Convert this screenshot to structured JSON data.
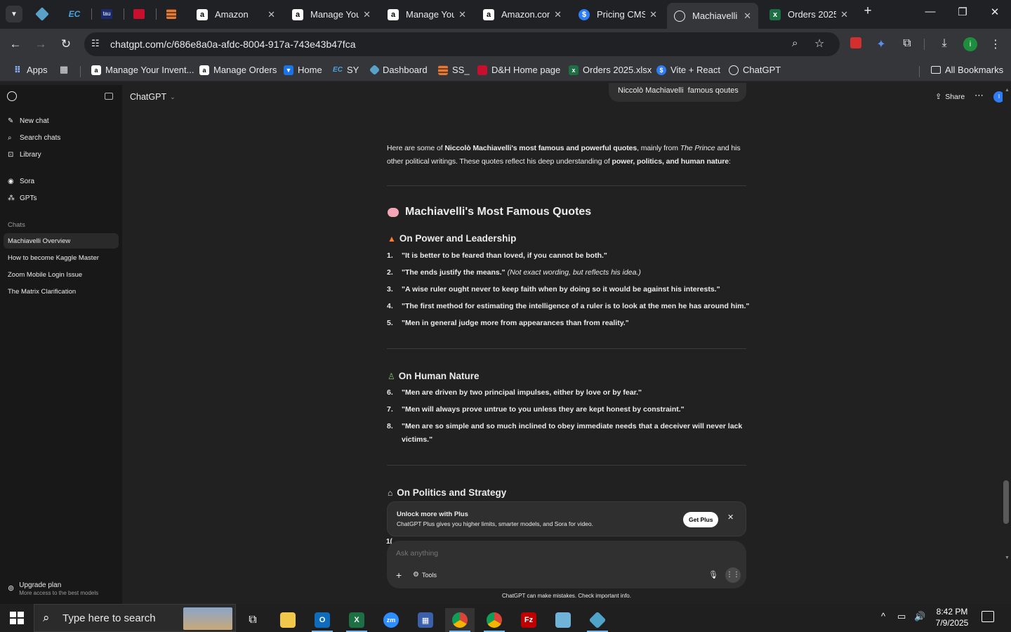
{
  "tabs": [
    {
      "label": "Amazon"
    },
    {
      "label": "Manage Your"
    },
    {
      "label": "Manage Your"
    },
    {
      "label": "Amazon.com"
    },
    {
      "label": "Pricing CMS"
    },
    {
      "label": "Machiavelli"
    },
    {
      "label": "Orders 2025"
    }
  ],
  "address": {
    "url": "chatgpt.com/c/686e8a0a-afdc-8004-917a-743e43b47fca"
  },
  "bookmarks": {
    "apps": "Apps",
    "items": [
      "Manage Your Invent...",
      "Manage Orders",
      "Home",
      "SY",
      "Dashboard",
      "SS_",
      "D&H Home page",
      "Orders 2025.xlsx",
      "Vite + React",
      "ChatGPT"
    ],
    "all": "All Bookmarks"
  },
  "sidebar": {
    "new_chat": "New chat",
    "search_chats": "Search chats",
    "library": "Library",
    "sora": "Sora",
    "gpts": "GPTs",
    "chats_heading": "Chats",
    "chats": [
      "Machiavelli Overview",
      "How to become Kaggle Master",
      "Zoom Mobile Login Issue",
      "The Matrix Clarification"
    ],
    "upgrade_title": "Upgrade plan",
    "upgrade_sub": "More access to the best models"
  },
  "header": {
    "model": "ChatGPT",
    "share": "Share",
    "avatar": "I"
  },
  "user_message": "Niccolò Machiavelli  famous qoutes",
  "response": {
    "intro_p1": "Here are some of ",
    "intro_b1": "Niccolò Machiavelli's most famous and powerful quotes",
    "intro_p2": ", mainly from ",
    "intro_i1": "The Prince",
    "intro_p3": " and his",
    "intro_line2a": "other political writings. These quotes reflect his deep understanding of ",
    "intro_b2": "power, politics, and human nature",
    "intro_p4": ":",
    "title": "Machiavelli's Most Famous Quotes",
    "section1": "On Power and Leadership",
    "s1_quotes": [
      {
        "n": "1.",
        "q": "\"It is better to be feared than loved, if you cannot be both.\"",
        "note": ""
      },
      {
        "n": "2.",
        "q": "\"The ends justify the means.\"",
        "note": " (Not exact wording, but reflects his idea.)"
      },
      {
        "n": "3.",
        "q": "\"A wise ruler ought never to keep faith when by doing so it would be against his interests.\"",
        "note": ""
      },
      {
        "n": "4.",
        "q": "\"The first method for estimating the intelligence of a ruler is to look at the men he has around him.\"",
        "note": ""
      },
      {
        "n": "5.",
        "q": "\"Men in general judge more from appearances than from reality.\"",
        "note": ""
      }
    ],
    "section2": "On Human Nature",
    "s2_quotes": [
      {
        "n": "6.",
        "q": "\"Men are driven by two principal impulses, either by love or by fear.\""
      },
      {
        "n": "7.",
        "q": "\"Men will always prove untrue to you unless they are kept honest by constraint.\""
      },
      {
        "n": "8.",
        "q": "\"Men are so simple and so much inclined to obey immediate needs that a deceiver will never lack",
        "q2": "victims.\""
      }
    ],
    "section3": "On Politics and Strategy",
    "next_num": "1("
  },
  "upsell": {
    "title": "Unlock more with Plus",
    "body": "ChatGPT Plus gives you higher limits, smarter models, and Sora for video.",
    "button": "Get Plus"
  },
  "composer": {
    "placeholder": "Ask anything",
    "tools": "Tools",
    "disclaimer": "ChatGPT can make mistakes. Check important info."
  },
  "taskbar": {
    "search_placeholder": "Type here to search",
    "time": "8:42 PM",
    "date": "7/9/2025"
  },
  "colors": {
    "accent": "#2f7df6",
    "amazon": "#ffffff",
    "excel": "#1d7044",
    "chrome_bg": "#202124"
  }
}
